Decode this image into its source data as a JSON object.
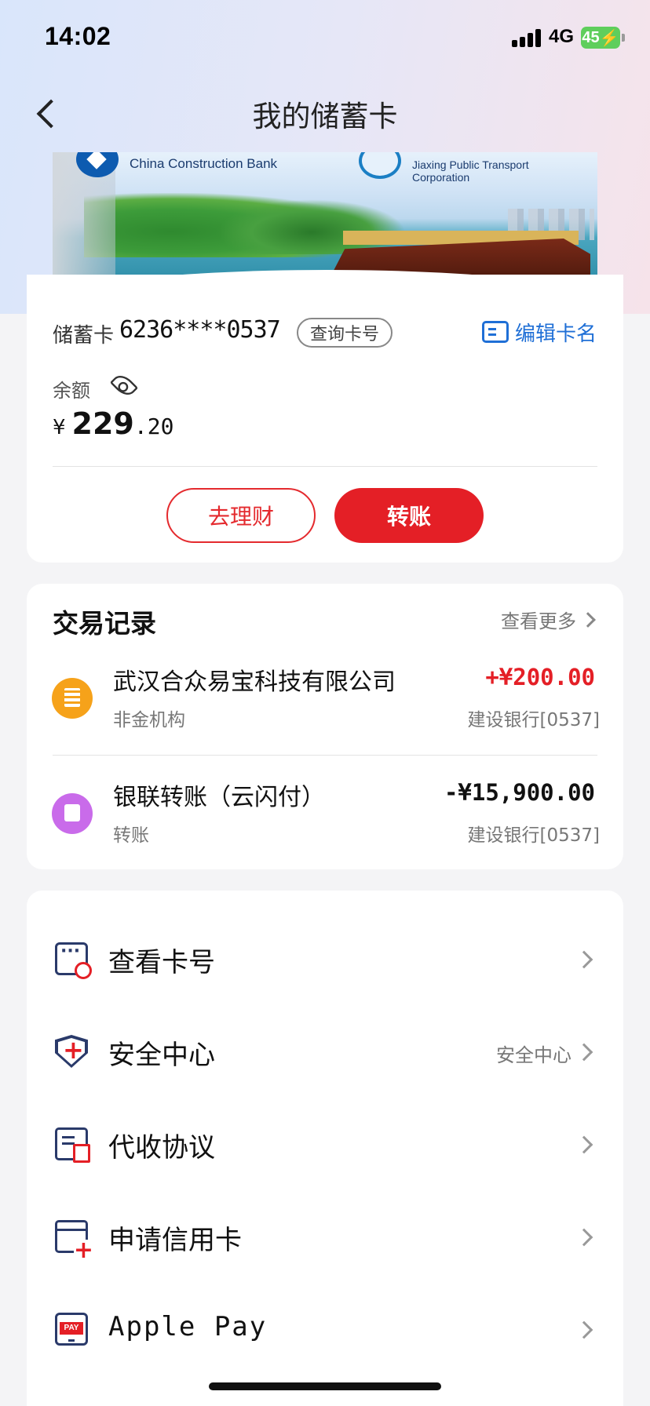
{
  "status_bar": {
    "time": "14:02",
    "network": "4G",
    "battery": "45"
  },
  "nav": {
    "title": "我的储蓄卡"
  },
  "card_image": {
    "bank_name_en": "China Construction Bank",
    "partner_name_en": "Jiaxing Public Transport Corporation"
  },
  "account": {
    "type_label": "储蓄卡",
    "card_number": "6236****0537",
    "query_label": "查询卡号",
    "edit_label": "编辑卡名",
    "balance_label": "余额",
    "currency_symbol": "¥",
    "balance_integer": "229",
    "balance_decimal": ".20",
    "invest_label": "去理财",
    "transfer_label": "转账"
  },
  "transactions": {
    "title": "交易记录",
    "more_label": "查看更多",
    "items": [
      {
        "name": "武汉合众易宝科技有限公司",
        "category": "非金机构",
        "amount": "+¥200.00",
        "account": "建设银行[0537]"
      },
      {
        "name": "银联转账（云闪付）",
        "category": "转账",
        "amount": "-¥15,900.00",
        "account": "建设银行[0537]"
      }
    ]
  },
  "menu": {
    "items": [
      {
        "label": "查看卡号",
        "extra": ""
      },
      {
        "label": "安全中心",
        "extra": "安全中心"
      },
      {
        "label": "代收协议",
        "extra": ""
      },
      {
        "label": "申请信用卡",
        "extra": ""
      },
      {
        "label": "Apple Pay",
        "extra": ""
      }
    ]
  },
  "colors": {
    "accent_red": "#e41f26",
    "link_blue": "#1f6fd6",
    "icon_navy": "#2a3a6a"
  }
}
